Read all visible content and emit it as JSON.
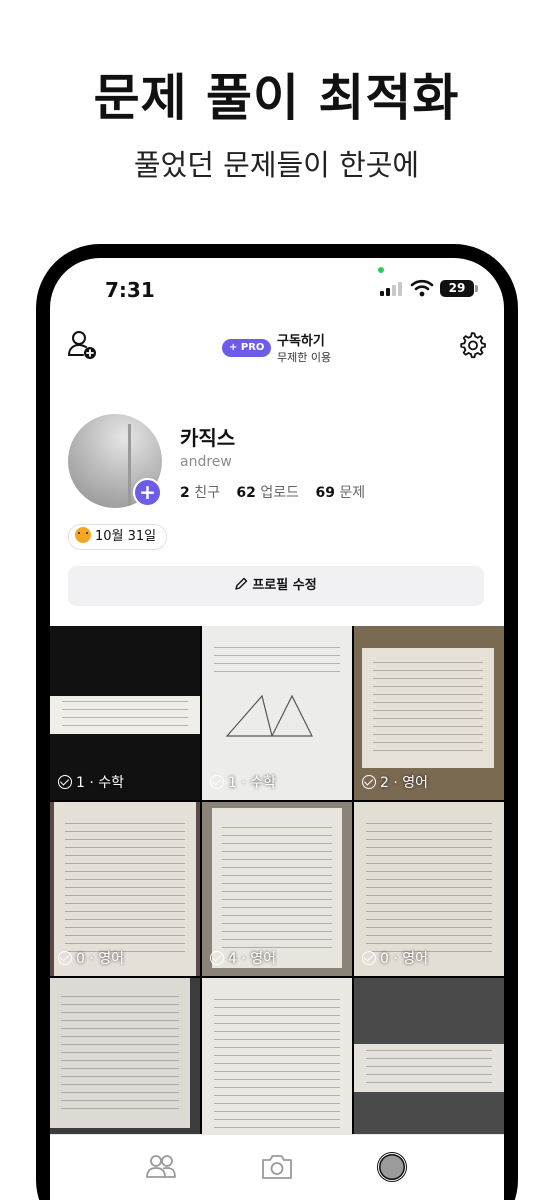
{
  "hero": {
    "title": "문제 풀이 최적화",
    "subtitle": "풀었던 문제들이 한곳에"
  },
  "status_bar": {
    "time": "7:31",
    "battery": "29",
    "icons": [
      "signal-icon",
      "wifi-icon",
      "battery-icon"
    ]
  },
  "topbar": {
    "add_friend_icon": "add-friend-icon",
    "pro_badge": "+ PRO",
    "subscribe_title": "구독하기",
    "subscribe_subtitle": "무제한 이용",
    "settings_icon": "gear-icon",
    "accent_color": "#6c5ce7"
  },
  "profile": {
    "name": "카직스",
    "username": "andrew",
    "avatar_add": "+",
    "stats": [
      {
        "value": "2",
        "label": "친구"
      },
      {
        "value": "62",
        "label": "업로드"
      },
      {
        "value": "69",
        "label": "문제"
      }
    ],
    "date_chip": "10월 31일",
    "date_chip_icon": "tiger-icon",
    "edit_button": "프로필 수정",
    "edit_icon": "pencil-icon"
  },
  "grid": {
    "items": [
      {
        "label": "1 · 수학"
      },
      {
        "label": "1 · 수학"
      },
      {
        "label": "2 · 영어"
      },
      {
        "label": "0 · 영어"
      },
      {
        "label": "4 · 영어"
      },
      {
        "label": "0 · 영어"
      },
      {
        "label": ""
      },
      {
        "label": ""
      },
      {
        "label": ""
      }
    ]
  },
  "tabbar": {
    "tabs": [
      {
        "icon": "friends-icon"
      },
      {
        "icon": "camera-icon"
      },
      {
        "icon": "profile-avatar-icon"
      }
    ]
  }
}
